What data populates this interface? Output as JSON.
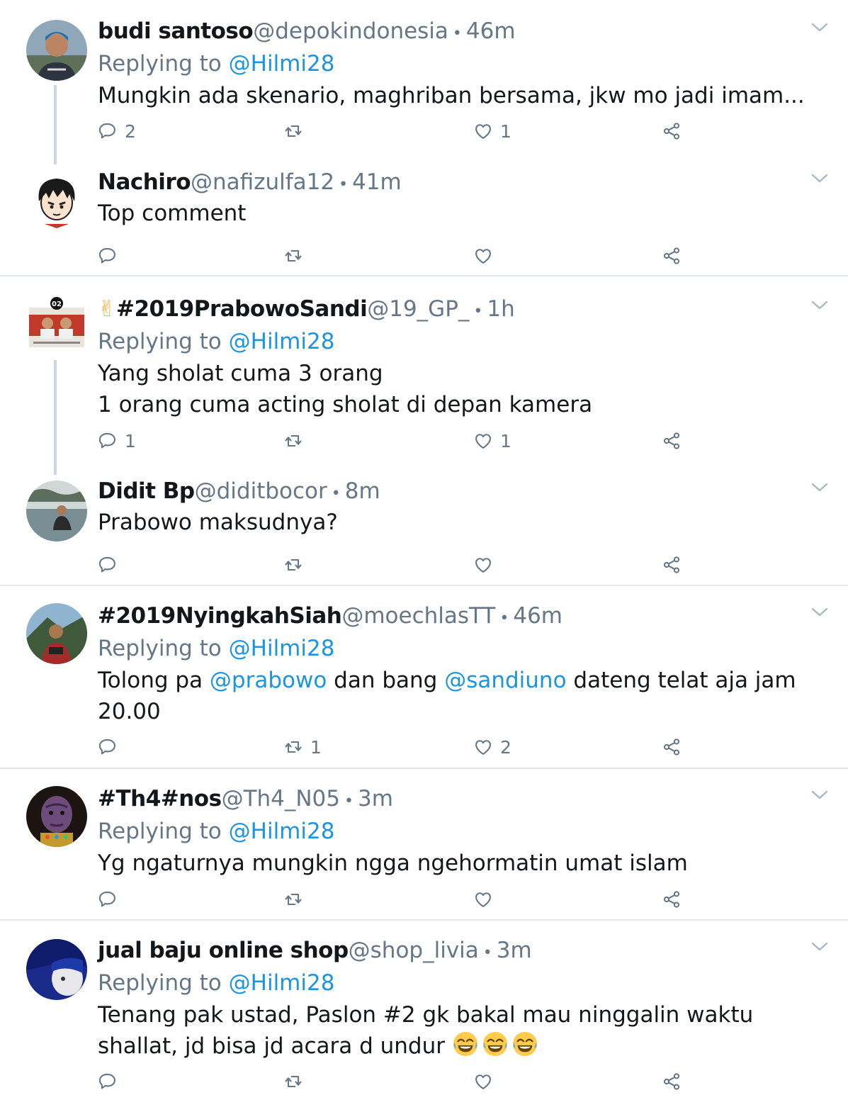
{
  "colors": {
    "link": "#1b95e0",
    "secondary": "#657786",
    "text": "#14171a",
    "divider": "#e1e8ed",
    "thread_line": "#ccd6dd"
  },
  "tweets": [
    {
      "name": "budi santoso",
      "handle": "@depokindonesia",
      "dot": "•",
      "time": "46m",
      "replying_prefix": "Replying to",
      "replying_to": "@Hilmi28",
      "text": "Mungkin ada skenario, maghriban bersama, jkw mo jadi imam...",
      "reply_count": "2",
      "retweet_count": "",
      "like_count": "1"
    },
    {
      "name": "Nachiro",
      "handle": "@nafizulfa12",
      "dot": "•",
      "time": "41m",
      "text": "Top comment",
      "reply_count": "",
      "retweet_count": "",
      "like_count": ""
    },
    {
      "name_emoji": "✌",
      "name": "#2019PrabowoSandi",
      "handle": "@19_GP_",
      "dot": "•",
      "time": "1h",
      "avatar_badge": "02",
      "replying_prefix": "Replying to",
      "replying_to": "@Hilmi28",
      "text_line1": "Yang sholat cuma 3 orang",
      "text_line2": "1 orang cuma acting sholat di depan kamera",
      "reply_count": "1",
      "retweet_count": "",
      "like_count": "1"
    },
    {
      "name": "Didit Bp",
      "handle": "@diditbocor",
      "dot": "•",
      "time": "8m",
      "text": "Prabowo maksudnya?",
      "reply_count": "",
      "retweet_count": "",
      "like_count": ""
    },
    {
      "name": "#2019NyingkahSiah",
      "handle": "@moechlasTT",
      "dot": "•",
      "time": "46m",
      "replying_prefix": "Replying to",
      "replying_to": "@Hilmi28",
      "text_part1": "Tolong pa ",
      "mention1": "@prabowo",
      "text_part2": " dan bang ",
      "mention2": "@sandiuno",
      "text_part3": " dateng telat aja jam 20.00",
      "reply_count": "",
      "retweet_count": "1",
      "like_count": "2"
    },
    {
      "name": "#Th4#nos",
      "handle": "@Th4_N05",
      "dot": "•",
      "time": "3m",
      "replying_prefix": "Replying to",
      "replying_to": "@Hilmi28",
      "text": "Yg ngaturnya mungkin ngga ngehormatin umat islam",
      "reply_count": "",
      "retweet_count": "",
      "like_count": ""
    },
    {
      "name": "jual baju online shop",
      "handle": "@shop_livia",
      "dot": "•",
      "time": "3m",
      "replying_prefix": "Replying to",
      "replying_to": "@Hilmi28",
      "text_line1": "Tenang pak ustad, Paslon #2 gk bakal mau ninggalin waktu",
      "text_line2": "shallat, jd bisa jd acara d undur ",
      "emoji": "face-with-tears-of-joy x3",
      "reply_count": "",
      "retweet_count": "",
      "like_count": ""
    }
  ],
  "icons": {
    "reply": "reply-icon",
    "retweet": "retweet-icon",
    "like": "heart-icon",
    "share": "share-icon",
    "menu": "chevron-down-icon"
  }
}
